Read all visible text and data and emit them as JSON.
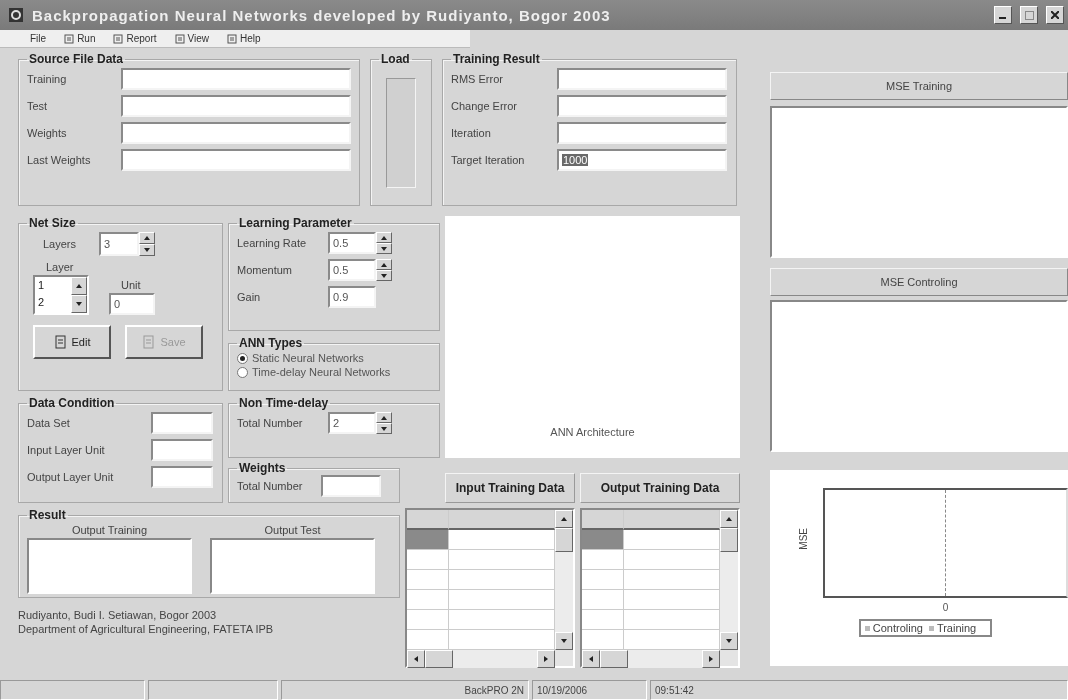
{
  "window": {
    "title": "Backpropagation Neural Networks developed by Rudiyanto, Bogor 2003"
  },
  "menu": [
    {
      "label": "File"
    },
    {
      "label": "Run"
    },
    {
      "label": "Report"
    },
    {
      "label": "View"
    },
    {
      "label": "Help"
    }
  ],
  "source_file_data": {
    "title": "Source File Data",
    "fields": [
      {
        "label": "Training"
      },
      {
        "label": "Test"
      },
      {
        "label": "Weights"
      },
      {
        "label": "Last Weights"
      }
    ]
  },
  "load": {
    "title": "Load"
  },
  "training_result": {
    "title": "Training Result",
    "fields": [
      {
        "label": "RMS Error",
        "selected": false
      },
      {
        "label": "Change Error",
        "selected": false
      },
      {
        "label": "Iteration",
        "selected": false
      },
      {
        "label": "Target Iteration",
        "value": "1000",
        "selected": true
      }
    ]
  },
  "mse_training": {
    "title": "MSE Training"
  },
  "mse_controlling": {
    "title": "MSE Controling"
  },
  "net_size": {
    "title": "Net Size",
    "layers_label": "Layers",
    "layers_value": "3",
    "layer_label": "Layer",
    "layer_items": [
      {
        "label": "1"
      },
      {
        "label": "2"
      }
    ],
    "unit_label": "Unit",
    "unit_value": "0",
    "buttons": [
      {
        "label": "Edit",
        "disabled": false
      },
      {
        "label": "Save",
        "disabled": true
      }
    ]
  },
  "learning_parameter": {
    "title": "Learning Parameter",
    "fields": [
      {
        "label": "Learning Rate",
        "value": "0.5",
        "kind": "spin"
      },
      {
        "label": "Momentum",
        "value": "0.5",
        "kind": "spin"
      },
      {
        "label": "Gain",
        "value": "0.9",
        "kind": "text"
      }
    ]
  },
  "ann_types": {
    "title": "ANN Types",
    "options": [
      {
        "label": "Static Neural Networks",
        "selected": true
      },
      {
        "label": "Time-delay Neural Networks",
        "selected": false
      }
    ]
  },
  "non_time_delay": {
    "title": "Non Time-delay",
    "label": "Total Number",
    "value": "2"
  },
  "weights": {
    "title": "Weights",
    "label": "Total Number"
  },
  "ann_architecture": {
    "caption": "ANN Architecture"
  },
  "data_condition": {
    "title": "Data Condition",
    "fields": [
      {
        "label": "Data Set"
      },
      {
        "label": "Input Layer Unit"
      },
      {
        "label": "Output Layer Unit"
      }
    ]
  },
  "result": {
    "title": "Result",
    "boxes": [
      {
        "label": "Output Training"
      },
      {
        "label": "Output Test"
      }
    ]
  },
  "credits": [
    "Rudiyanto, Budi I. Setiawan, Bogor 2003",
    "Department of Agricultural Engineering, FATETA IPB"
  ],
  "input_training_data": {
    "title": "Input Training Data",
    "rows": [
      {
        "selected": true
      },
      {
        "selected": false
      },
      {
        "selected": false
      },
      {
        "selected": false
      },
      {
        "selected": false
      },
      {
        "selected": false
      }
    ]
  },
  "output_training_data": {
    "title": "Output Training Data",
    "rows": [
      {
        "selected": true
      },
      {
        "selected": false
      },
      {
        "selected": false
      },
      {
        "selected": false
      },
      {
        "selected": false
      },
      {
        "selected": false
      }
    ]
  },
  "mse_chart": {
    "ylabel": "MSE",
    "xtick": "0",
    "legend": [
      "Controling",
      "Training"
    ]
  },
  "status_bar": [
    "BackPRO 2N",
    "10/19/2006",
    "09:51:42"
  ]
}
